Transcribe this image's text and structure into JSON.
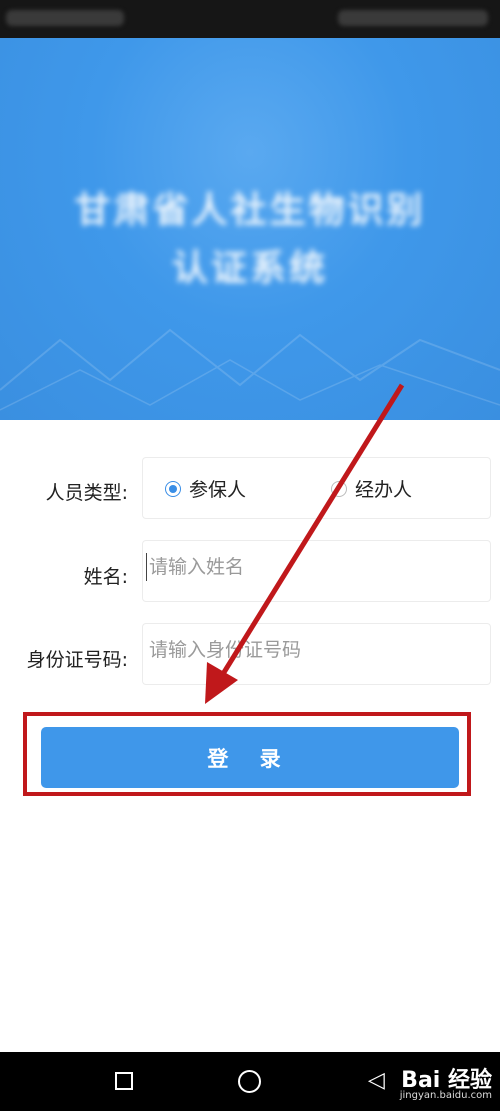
{
  "banner": {
    "title_line1": "甘肃省人社生物识别",
    "title_line2": "认证系统"
  },
  "form": {
    "person_type_label": "人员类型:",
    "options": [
      "参保人",
      "经办人"
    ],
    "selected_option": "参保人",
    "name_label": "姓名:",
    "name_placeholder": "请输入姓名",
    "name_value": "",
    "id_label": "身份证号码:",
    "id_placeholder": "请输入身份证号码",
    "id_value": ""
  },
  "login_label": "登 录",
  "watermark": {
    "brand": "Bai 经验",
    "url": "jingyan.baidu.com"
  },
  "colors": {
    "accent": "#3f97ea",
    "highlight": "#c0181b"
  }
}
